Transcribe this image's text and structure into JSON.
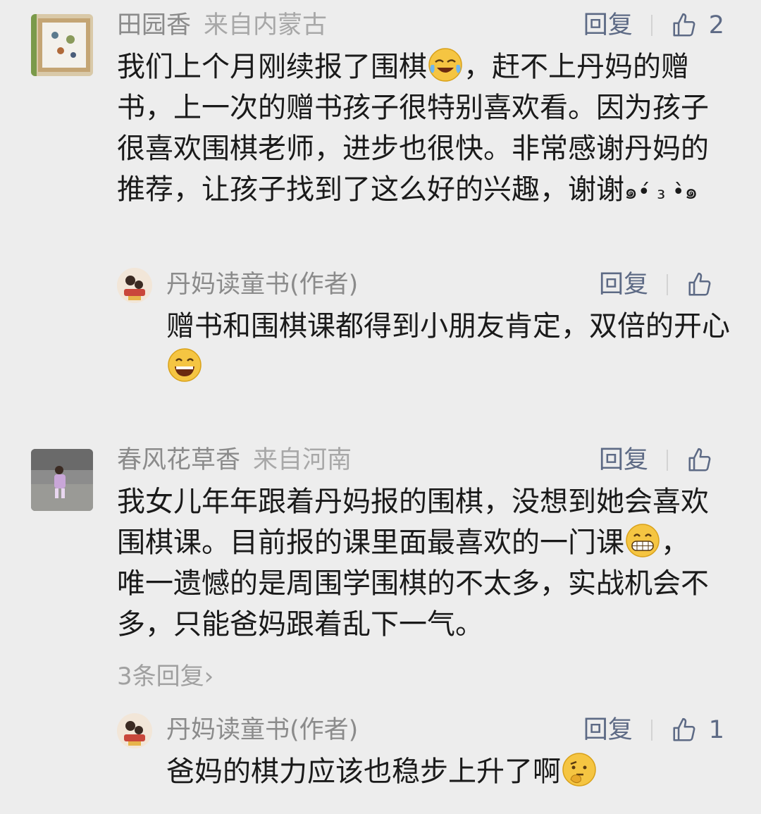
{
  "comments": [
    {
      "name": "田园香",
      "location": "来自内蒙古",
      "reply_label": "回复",
      "like_count": "2",
      "text_parts": [
        "我们上个月刚续报了围棋",
        "，赶不上丹妈的赠书，上一次的赠书孩子很特别喜欢看。因为孩子很喜欢围棋老师，进步也很快。非常感谢丹妈的推荐，让孩子找到了这么好的兴趣，谢谢",
        "๑•́ ₃ •̀๑"
      ],
      "emoji": "tears-of-joy-emoji",
      "author_reply": {
        "name": "丹妈读童书(作者)",
        "reply_label": "回复",
        "like_count": "",
        "text": "赠书和围棋课都得到小朋友肯定，双倍的开心",
        "emoji": "grinning-emoji"
      }
    },
    {
      "name": "春风花草香",
      "location": "来自河南",
      "reply_label": "回复",
      "like_count": "",
      "text_parts": [
        "我女儿年年跟着丹妈报的围棋，没想到她会喜欢围棋课。目前报的课里面最喜欢的一门课",
        "，唯一遗憾的是周围学围棋的不太多，实战机会不多，只能爸妈跟着乱下一气。"
      ],
      "emoji": "grimacing-emoji",
      "more_replies": "3条回复›",
      "author_reply": {
        "name": "丹妈读童书(作者)",
        "reply_label": "回复",
        "like_count": "1",
        "text": "爸妈的棋力应该也稳步上升了啊",
        "emoji": "thinking-emoji"
      }
    }
  ],
  "colors": {
    "background": "#ededed",
    "link": "#5d6a85",
    "meta": "#8b8b8b",
    "text": "#1a1a1a"
  }
}
